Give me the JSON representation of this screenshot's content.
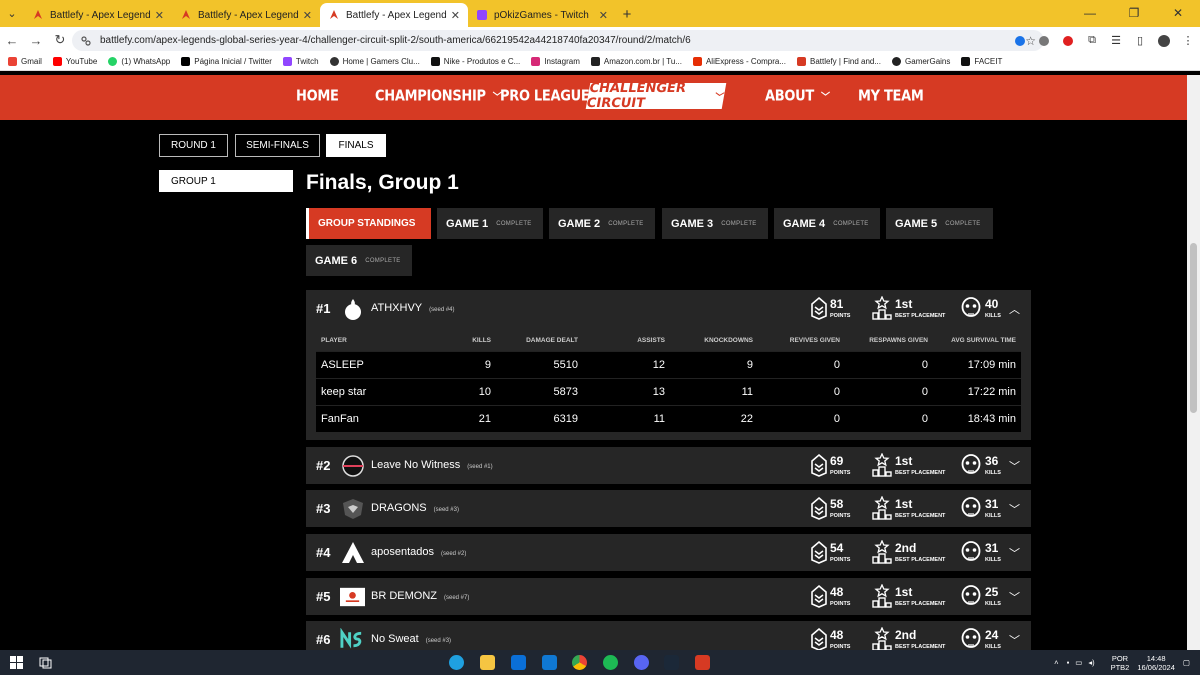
{
  "browser": {
    "tabs": [
      {
        "title": "Battlefy - Apex Legends Global",
        "active": false
      },
      {
        "title": "Battlefy - Apex Legends Global",
        "active": false
      },
      {
        "title": "Battlefy - Apex Legends Global",
        "active": true
      },
      {
        "title": "pOkizGames - Twitch",
        "active": false
      }
    ],
    "url": "battlefy.com/apex-legends-global-series-year-4/challenger-circuit-split-2/south-america/66219542a44218740fa20347/round/2/match/6",
    "bookmarks": [
      "Gmail",
      "YouTube",
      "(1) WhatsApp",
      "Página Inicial / Twitter",
      "Twitch",
      "Home | Gamers Clu...",
      "Nike - Produtos e C...",
      "Instagram",
      "Amazon.com.br | Tu...",
      "AliExpress - Compra...",
      "Battlefy | Find and...",
      "GamerGains",
      "FACEIT"
    ]
  },
  "sitenav": {
    "home": "HOME",
    "championship": "CHAMPIONSHIP",
    "proleague": "PRO LEAGUE",
    "challenger": "CHALLENGER CIRCUIT",
    "about": "ABOUT",
    "myteam": "MY TEAM"
  },
  "rounds": [
    "ROUND 1",
    "SEMI-FINALS",
    "FINALS"
  ],
  "group_select": "GROUP 1",
  "page_title": "Finals, Group 1",
  "game_tabs": {
    "standings": "GROUP STANDINGS",
    "games": [
      {
        "name": "GAME 1",
        "status": "COMPLETE"
      },
      {
        "name": "GAME 2",
        "status": "COMPLETE"
      },
      {
        "name": "GAME 3",
        "status": "COMPLETE"
      },
      {
        "name": "GAME 4",
        "status": "COMPLETE"
      },
      {
        "name": "GAME 5",
        "status": "COMPLETE"
      },
      {
        "name": "GAME 6",
        "status": "COMPLETE"
      }
    ]
  },
  "labels": {
    "points": "POINTS",
    "best": "BEST PLACEMENT",
    "kills": "KILLS"
  },
  "teams": [
    {
      "rank": "#1",
      "name": "ATHXHVY",
      "seed": "(seed #4)",
      "points": "81",
      "best": "1st",
      "kills": "40"
    },
    {
      "rank": "#2",
      "name": "Leave No Witness",
      "seed": "(seed #1)",
      "points": "69",
      "best": "1st",
      "kills": "36"
    },
    {
      "rank": "#3",
      "name": "DRAGONS",
      "seed": "(seed #3)",
      "points": "58",
      "best": "1st",
      "kills": "31"
    },
    {
      "rank": "#4",
      "name": "aposentados",
      "seed": "(seed #2)",
      "points": "54",
      "best": "2nd",
      "kills": "31"
    },
    {
      "rank": "#5",
      "name": "BR DEMONZ",
      "seed": "(seed #7)",
      "points": "48",
      "best": "1st",
      "kills": "25"
    },
    {
      "rank": "#6",
      "name": "No Sweat",
      "seed": "(seed #3)",
      "points": "48",
      "best": "2nd",
      "kills": "24"
    }
  ],
  "player_table": {
    "headers": [
      "PLAYER",
      "KILLS",
      "DAMAGE DEALT",
      "ASSISTS",
      "KNOCKDOWNS",
      "REVIVES GIVEN",
      "RESPAWNS GIVEN",
      "AVG SURVIVAL TIME"
    ],
    "rows": [
      [
        "ASLEEP",
        "9",
        "5510",
        "12",
        "9",
        "0",
        "0",
        "17:09 min"
      ],
      [
        "keep star",
        "10",
        "5873",
        "13",
        "11",
        "0",
        "0",
        "17:22 min"
      ],
      [
        "FanFan",
        "21",
        "6319",
        "11",
        "22",
        "0",
        "0",
        "18:43 min"
      ]
    ]
  },
  "taskbar": {
    "lang": "POR",
    "layout": "PTB2",
    "time": "14:48",
    "date": "16/06/2024"
  },
  "colors": {
    "brand": "#d63a23",
    "row": "#262626",
    "tabbar": "#f2c32a"
  }
}
